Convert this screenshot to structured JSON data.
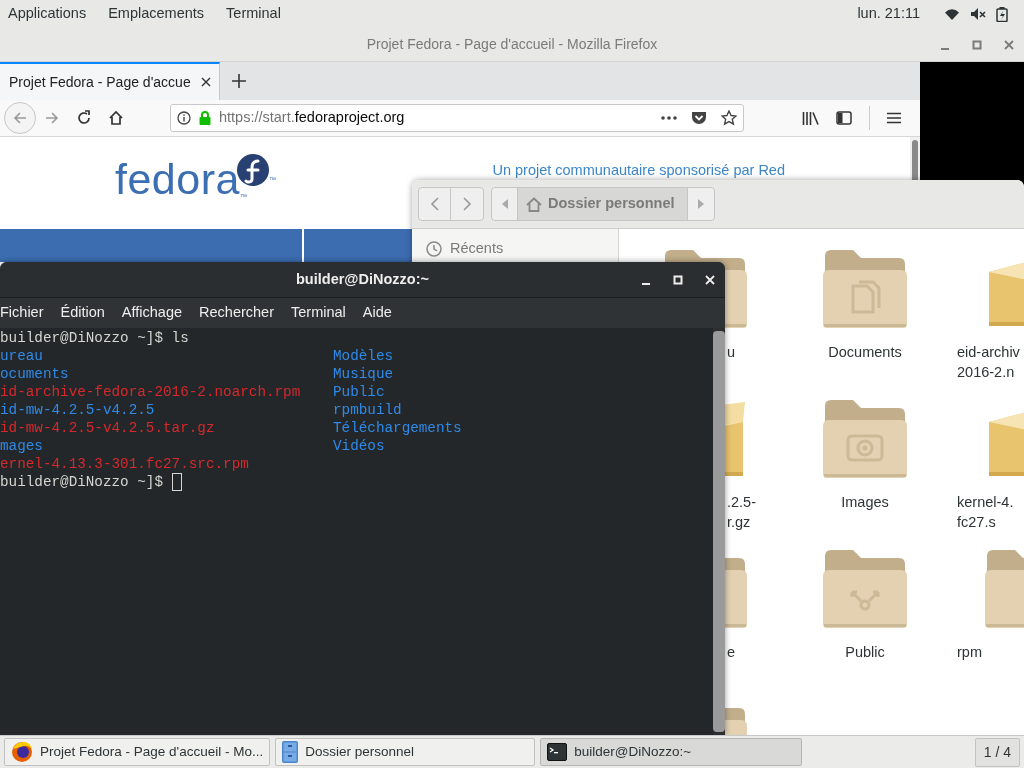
{
  "top_bar": {
    "menus": [
      "Applications",
      "Emplacements",
      "Terminal"
    ],
    "clock": "lun. 21:11"
  },
  "browser": {
    "title": "Projet Fedora - Page d'accueil - Mozilla Firefox",
    "tabs": [
      {
        "label": "Projet Fedora - Page d'accue",
        "selected": true
      }
    ],
    "url": {
      "prefix": "https://start.",
      "domain": "fedoraproject.org"
    },
    "page": {
      "logo": "fedora",
      "trademarks": [
        "™",
        "™"
      ],
      "tagline": "Un projet communautaire sponsorisé par Red"
    }
  },
  "file_manager": {
    "location": "Dossier personnel",
    "sidebar": [
      {
        "label": "Récents",
        "selected": false
      }
    ],
    "items": [
      {
        "kind": "folder",
        "lines": [
          "u"
        ]
      },
      {
        "kind": "documents",
        "lines": [
          "Documents"
        ]
      },
      {
        "kind": "package",
        "lines": [
          "eid-archiv",
          "2016-2.n"
        ]
      },
      {
        "kind": "package",
        "lines": [
          ".2.5-",
          "r.gz"
        ]
      },
      {
        "kind": "pictures",
        "lines": [
          "Images"
        ]
      },
      {
        "kind": "package",
        "lines": [
          "kernel-4.",
          "fc27.s"
        ]
      },
      {
        "kind": "folder",
        "lines": [
          "e"
        ]
      },
      {
        "kind": "public",
        "lines": [
          "Public"
        ]
      },
      {
        "kind": "folder",
        "lines": [
          "rpm"
        ]
      },
      {
        "kind": "folder"
      }
    ]
  },
  "terminal": {
    "title": "builder@DiNozzo:~",
    "menus": [
      "Fichier",
      "Édition",
      "Affichage",
      "Rechercher",
      "Terminal",
      "Aide"
    ],
    "cursor": true,
    "lines": [
      [
        {
          "text": "builder@DiNozzo ~]$ ls",
          "kind": "plain"
        }
      ],
      [
        {
          "text": "ureau",
          "kind": "dir"
        },
        {
          "text": "Modèles",
          "kind": "dir"
        }
      ],
      [
        {
          "text": "ocuments",
          "kind": "dir"
        },
        {
          "text": "Musique",
          "kind": "dir"
        }
      ],
      [
        {
          "text": "id-archive-fedora-2016-2.noarch.rpm",
          "kind": "archive"
        },
        {
          "text": "Public",
          "kind": "dir"
        }
      ],
      [
        {
          "text": "id-mw-4.2.5-v4.2.5",
          "kind": "dir"
        },
        {
          "text": "rpmbuild",
          "kind": "dir"
        }
      ],
      [
        {
          "text": "id-mw-4.2.5-v4.2.5.tar.gz",
          "kind": "archive"
        },
        {
          "text": "Téléchargements",
          "kind": "dir"
        }
      ],
      [
        {
          "text": "mages",
          "kind": "dir"
        },
        {
          "text": "Vidéos",
          "kind": "dir"
        }
      ],
      [
        {
          "text": "ernel-4.13.3-301.fc27.src.rpm",
          "kind": "archive"
        }
      ],
      [
        {
          "text": "builder@DiNozzo ~]$",
          "kind": "plain"
        }
      ]
    ]
  },
  "taskbar": {
    "items": [
      {
        "label": "Projet Fedora - Page d'accueil - Mo...",
        "kind": "browser",
        "selected": false
      },
      {
        "label": "Dossier personnel",
        "kind": "files",
        "selected": false
      },
      {
        "label": "builder@DiNozzo:~",
        "kind": "terminal",
        "selected": true
      }
    ],
    "workspace": "1 / 4"
  }
}
